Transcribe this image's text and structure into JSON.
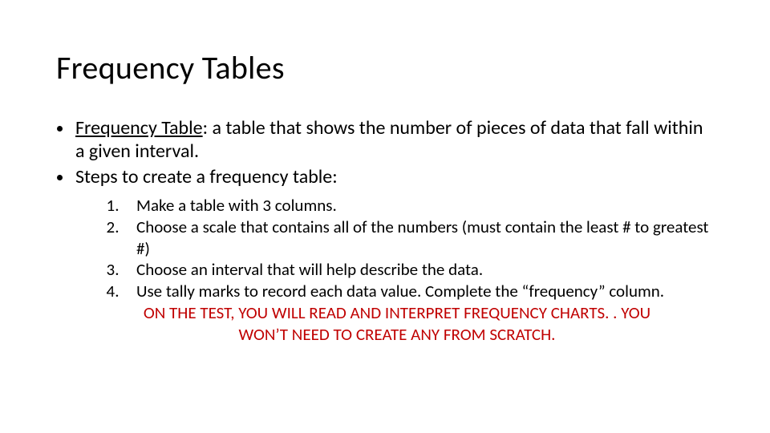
{
  "title": "Frequency Tables",
  "bullets": {
    "term": "Frequency Table",
    "definition": ": a table that shows the number of pieces of data that fall within a given interval.",
    "steps_intro": "Steps to create a frequency table:"
  },
  "steps": [
    "Make a table with 3 columns.",
    "Choose a scale that contains all of the numbers (must contain the least # to greatest #)",
    "Choose an interval that will help describe the data.",
    "Use tally marks to record each data value. Complete the “frequency” column."
  ],
  "note": "ON THE TEST, YOU WILL READ AND INTERPRET FREQUENCY CHARTS. . YOU WON’T NEED TO CREATE ANY FROM SCRATCH."
}
